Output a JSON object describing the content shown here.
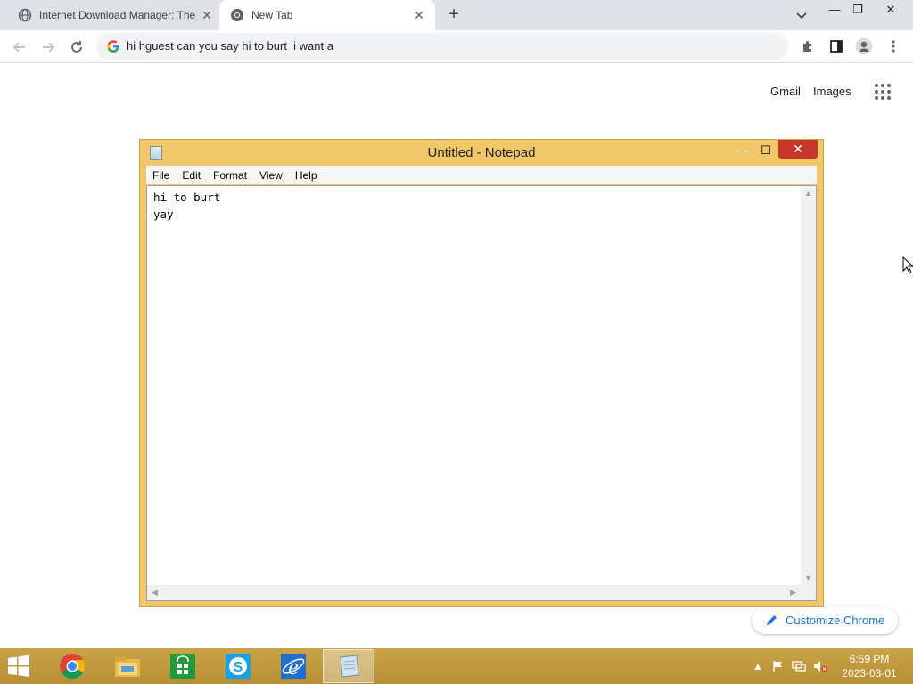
{
  "browser": {
    "tabs": [
      {
        "title": "Internet Download Manager: The",
        "close": "✕",
        "active": false
      },
      {
        "title": "New Tab",
        "close": "✕",
        "active": true
      }
    ],
    "new_tab_symbol": "+",
    "window_controls": {
      "minimize": "—",
      "restore": "❐",
      "close": "✕"
    },
    "address_bar": {
      "value": "hi hguest can you say hi to burt  i want a"
    }
  },
  "ntp": {
    "gmail": "Gmail",
    "images": "Images",
    "customize": "Customize Chrome"
  },
  "notepad": {
    "title": "Untitled - Notepad",
    "min": "—",
    "max": "☐",
    "close": "✕",
    "menu": [
      "File",
      "Edit",
      "Format",
      "View",
      "Help"
    ],
    "content": "hi to burt\nyay"
  },
  "taskbar": {
    "apps": [
      "chrome",
      "file-explorer",
      "store",
      "skype",
      "internet-explorer",
      "notepad"
    ],
    "time": "6:59 PM",
    "date": "2023-03-01"
  },
  "colors": {
    "notepad_frame": "#f0c869",
    "close_red": "#c7362a",
    "taskbar": "#c9a347",
    "link_blue": "#1a73e8"
  }
}
